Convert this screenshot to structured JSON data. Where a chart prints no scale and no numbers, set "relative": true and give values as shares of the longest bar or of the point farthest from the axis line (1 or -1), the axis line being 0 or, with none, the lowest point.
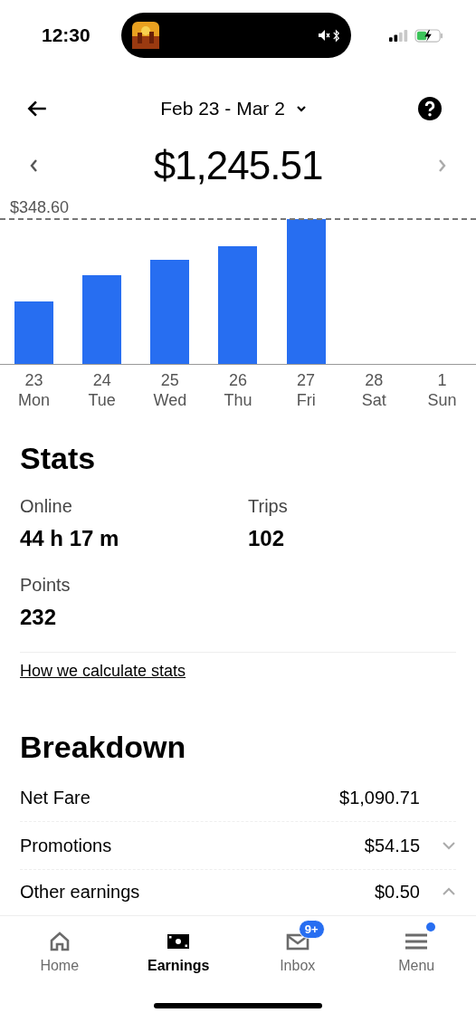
{
  "status_bar": {
    "time": "12:30"
  },
  "header": {
    "period": "Feb 23 - Mar 2",
    "total": "$1,245.51"
  },
  "chart": {
    "chart_data": {
      "type": "bar",
      "categories": [
        "23 Mon",
        "24 Tue",
        "25 Wed",
        "26 Thu",
        "27 Fri",
        "28 Sat",
        "1 Sun"
      ],
      "values": [
        0.43,
        0.61,
        0.72,
        0.81,
        1,
        null,
        null
      ],
      "relative": true,
      "annotations": [
        {
          "text": "$348.60"
        }
      ]
    }
  },
  "stats": {
    "title": "Stats",
    "items": [
      {
        "label": "Online",
        "value": "44 h 17 m"
      },
      {
        "label": "Trips",
        "value": "102"
      },
      {
        "label": "Points",
        "value": "232"
      }
    ],
    "link": "How we calculate stats"
  },
  "breakdown": {
    "title": "Breakdown",
    "rows": [
      {
        "label": "Net Fare",
        "amount": "$1,090.71",
        "kind": "plain"
      },
      {
        "label": "Promotions",
        "amount": "$54.15",
        "kind": "expandable",
        "expanded": false
      },
      {
        "label": "Other earnings",
        "amount": "$0.50",
        "kind": "expandable",
        "expanded": true
      }
    ]
  },
  "nav": [
    {
      "label": "Home",
      "selected": false
    },
    {
      "label": "Earnings",
      "selected": true
    },
    {
      "label": "Inbox",
      "selected": false,
      "badge": "9+"
    },
    {
      "label": "Menu",
      "selected": false,
      "dot": true
    }
  ]
}
